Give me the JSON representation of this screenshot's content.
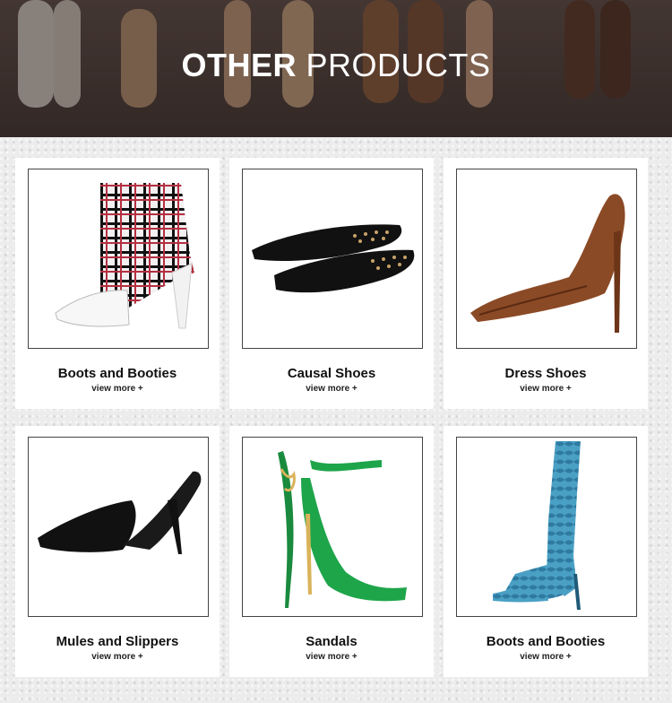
{
  "banner": {
    "title_bold": "OTHER",
    "title_rest": " PRODUCTS"
  },
  "products": [
    {
      "title": "Boots and Booties",
      "more": "view more +",
      "icon": "plaid-bootie-icon",
      "colors": {
        "main": "#8a1f2e",
        "accent": "#ffffff"
      }
    },
    {
      "title": "Causal Shoes",
      "more": "view more +",
      "icon": "studded-flat-icon",
      "colors": {
        "main": "#111111",
        "accent": "#c8a26a"
      }
    },
    {
      "title": "Dress Shoes",
      "more": "view more +",
      "icon": "brown-pump-icon",
      "colors": {
        "main": "#8b4a26",
        "accent": "#6d3518"
      }
    },
    {
      "title": "Mules and Slippers",
      "more": "view more +",
      "icon": "black-mule-icon",
      "colors": {
        "main": "#111111",
        "accent": "#222222"
      }
    },
    {
      "title": "Sandals",
      "more": "view more +",
      "icon": "green-sandal-icon",
      "colors": {
        "main": "#1ea54a",
        "accent": "#d9b35a"
      }
    },
    {
      "title": "Boots and Booties",
      "more": "view more +",
      "icon": "snakeskin-boot-icon",
      "colors": {
        "main": "#3f8fb5",
        "accent": "#1f5a78"
      }
    }
  ]
}
